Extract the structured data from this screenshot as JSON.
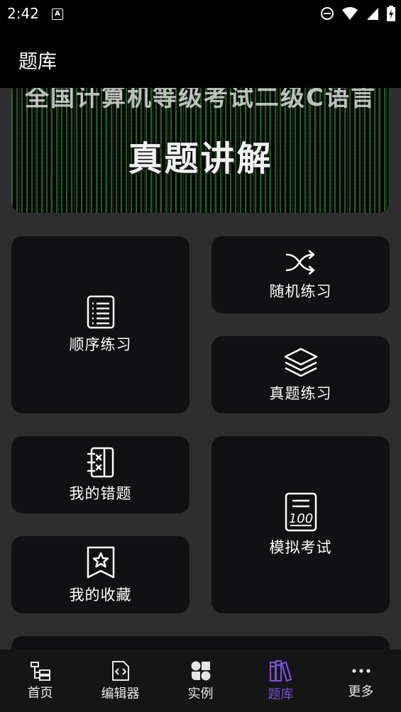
{
  "status": {
    "time": "2:42"
  },
  "appbar": {
    "title": "题库"
  },
  "banner": {
    "top_text": "全国计算机等级考试二级C语言",
    "main_text": "真题讲解"
  },
  "cards": {
    "sequential": "顺序练习",
    "random": "随机练习",
    "real_exam": "真题练习",
    "mistakes": "我的错题",
    "mock_exam": "模拟考试",
    "favorites": "我的收藏"
  },
  "nav": {
    "items": [
      {
        "label": "首页",
        "icon": "home-tree-icon"
      },
      {
        "label": "编辑器",
        "icon": "code-file-icon"
      },
      {
        "label": "实例",
        "icon": "examples-icon"
      },
      {
        "label": "题库",
        "icon": "library-icon"
      },
      {
        "label": "更多",
        "icon": "more-dots-icon"
      }
    ],
    "active_index": 3,
    "active_color": "#7a4fd8"
  }
}
